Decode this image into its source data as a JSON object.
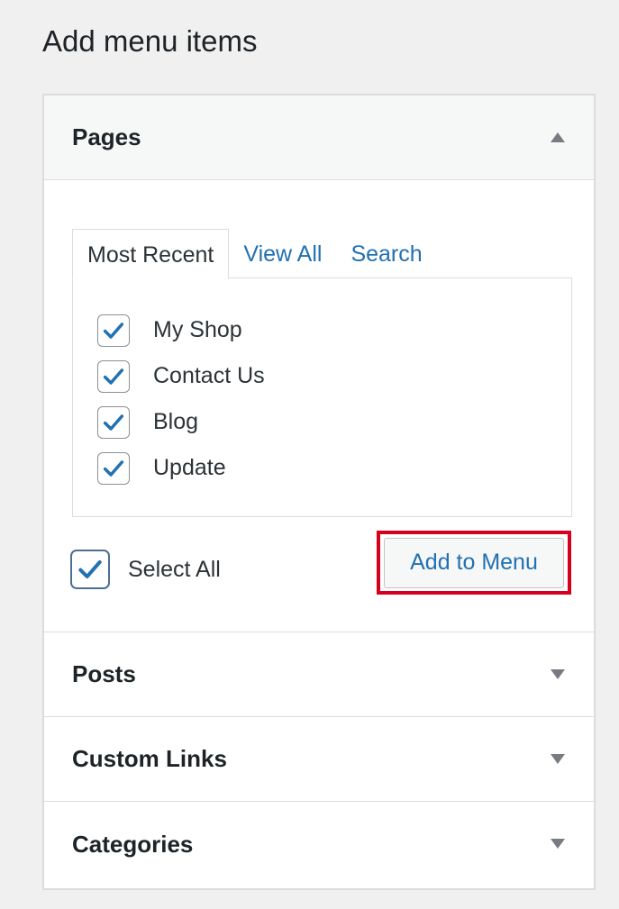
{
  "page_title": "Add menu items",
  "sections": {
    "pages": {
      "title": "Pages",
      "tabs": [
        {
          "label": "Most Recent"
        },
        {
          "label": "View All"
        },
        {
          "label": "Search"
        }
      ],
      "items": [
        {
          "label": "My Shop",
          "checked": true
        },
        {
          "label": "Contact Us",
          "checked": true
        },
        {
          "label": "Blog",
          "checked": true
        },
        {
          "label": "Update",
          "checked": true
        }
      ],
      "select_all_label": "Select All",
      "add_button_label": "Add to Menu"
    },
    "posts": {
      "title": "Posts"
    },
    "custom_links": {
      "title": "Custom Links"
    },
    "categories": {
      "title": "Categories"
    }
  },
  "colors": {
    "link": "#2271b1",
    "check": "#2271b1",
    "highlight": "#d6001c",
    "background": "#f0f0f1"
  },
  "icons": {
    "pages_toggle": "arrow-up-icon",
    "posts_toggle": "arrow-down-icon",
    "custom_links_toggle": "arrow-down-icon",
    "categories_toggle": "arrow-down-icon",
    "checkbox": "checkmark-icon"
  }
}
